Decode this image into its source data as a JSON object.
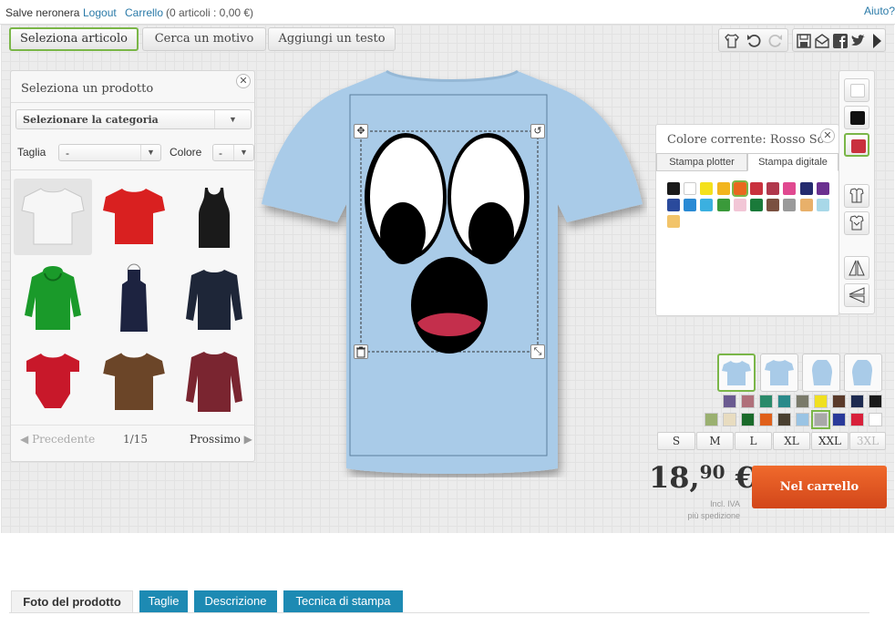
{
  "topbar": {
    "greeting": "Salve neronera",
    "logout": "Logout",
    "cart": "Carrello",
    "cart_info": "(0 articoli : 0,00 €)",
    "help": "Aiuto?"
  },
  "tabs": [
    {
      "label": "Seleziona articolo"
    },
    {
      "label": "Cerca un motivo"
    },
    {
      "label": "Aggiungi un testo"
    }
  ],
  "product_panel": {
    "title": "Seleziona un prodotto",
    "category_select": "Selezionare la categoria",
    "size_label": "Taglia",
    "size_value": "-",
    "color_label": "Colore",
    "color_value": "-",
    "products": [
      {
        "name": "white-tshirt",
        "color": "#f4f4f4"
      },
      {
        "name": "red-tshirt",
        "color": "#d92020"
      },
      {
        "name": "black-tanktop",
        "color": "#1a1a1a"
      },
      {
        "name": "green-hoodie",
        "color": "#1a9a2a"
      },
      {
        "name": "navy-apron",
        "color": "#1d2340"
      },
      {
        "name": "navy-longsleeve",
        "color": "#1e2638"
      },
      {
        "name": "red-baby-bodysuit",
        "color": "#c8182a"
      },
      {
        "name": "brown-ringer-tshirt",
        "color": "#6b4528"
      },
      {
        "name": "burgundy-longsleeve",
        "color": "#7a2530"
      }
    ],
    "prev": "Precedente",
    "page": "1/15",
    "next": "Prossimo"
  },
  "color_panel": {
    "title": "Colore corrente: Rosso Scuro",
    "tab_plotter": "Stampa plotter",
    "tab_digital": "Stampa digitale",
    "selected_index": 4,
    "swatches": [
      "#1a1a1a",
      "#ffffff",
      "#f4e11c",
      "#f2b51e",
      "#e9681f",
      "#c9313e",
      "#b0384c",
      "#e04990",
      "#242b6e",
      "#6a3090",
      "#2a4a9c",
      "#2a8ad4",
      "#3bb0e0",
      "#3a9a3a",
      "#f2c6d6",
      "#1a7a3a",
      "#7a5040",
      "#9a9a9a",
      "#e8b06a",
      "#a8d8e8",
      "#f2c46a"
    ]
  },
  "product_colors": {
    "selected_index": 15,
    "row1": [
      "#6a5a90",
      "#b0707a",
      "#2a8a6a",
      "#2a8a8a",
      "#7a7a6a",
      "#f0e020",
      "#5a3a2a",
      "#1d2a50",
      "#1a1a1a"
    ],
    "row2": [
      "#9ab070",
      "#e8dcc0",
      "#1a6a2a",
      "#e0601a",
      "#4a4030",
      "#9ac4e4",
      "#a8a8a8",
      "#2a3a9a",
      "#d8203a",
      "#ffffff"
    ]
  },
  "sizes": [
    {
      "label": "S"
    },
    {
      "label": "M"
    },
    {
      "label": "L"
    },
    {
      "label": "XL"
    },
    {
      "label": "XXL"
    },
    {
      "label": "3XL"
    }
  ],
  "price": {
    "main": "18,",
    "cents": "90",
    "currency": " €",
    "incl": "Incl. IVA",
    "shipping": "più spedizione"
  },
  "cart_button": "Nel carrello",
  "bottom_tabs": [
    {
      "label": "Foto del prodotto"
    },
    {
      "label": "Taglie"
    },
    {
      "label": "Descrizione"
    },
    {
      "label": "Tecnica di stampa"
    }
  ],
  "colors": {
    "accent_green": "#7ab648",
    "shirt": "#a9cbe8",
    "cart_orange": "#e0561f",
    "tab_blue": "#1d8ab3"
  }
}
